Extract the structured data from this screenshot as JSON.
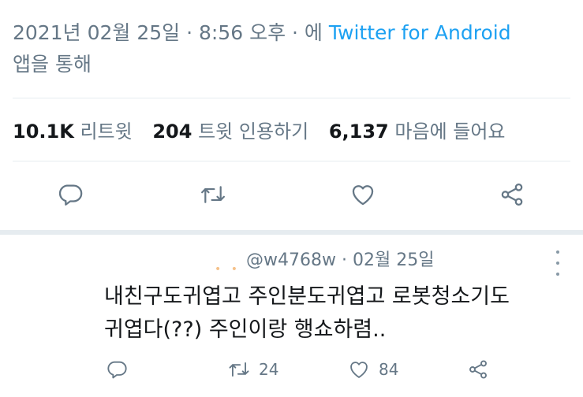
{
  "tweet": {
    "timestamp": "2021년 02월 25일 · 8:56 오후 · 에",
    "source": "Twitter for Android",
    "via_suffix": "앱을 통해",
    "stats": {
      "retweets_count": "10.1K",
      "retweets_label": "리트윗",
      "quotes_count": "204",
      "quotes_label": "트윗 인용하기",
      "likes_count": "6,137",
      "likes_label": "마음에 들어요"
    }
  },
  "reply": {
    "handle": "@w4768w",
    "separator": "·",
    "date": "02월 25일",
    "text_line1": "내친구도귀엽고 주인분도귀엽고 로봇청소기도",
    "text_line2": "귀엽다(??) 주인이랑 행쇼하렴..",
    "retweet_count": "24",
    "like_count": "84"
  },
  "icons": {
    "reply": "comment-bubble-icon",
    "retweet": "retweet-icon",
    "like": "heart-icon",
    "share": "share-icon",
    "more": "more-vertical-icon"
  },
  "colors": {
    "accent": "#1da1f2",
    "secondary_text": "#657786",
    "primary_text": "#14171a",
    "divider": "#e6ecf0"
  }
}
